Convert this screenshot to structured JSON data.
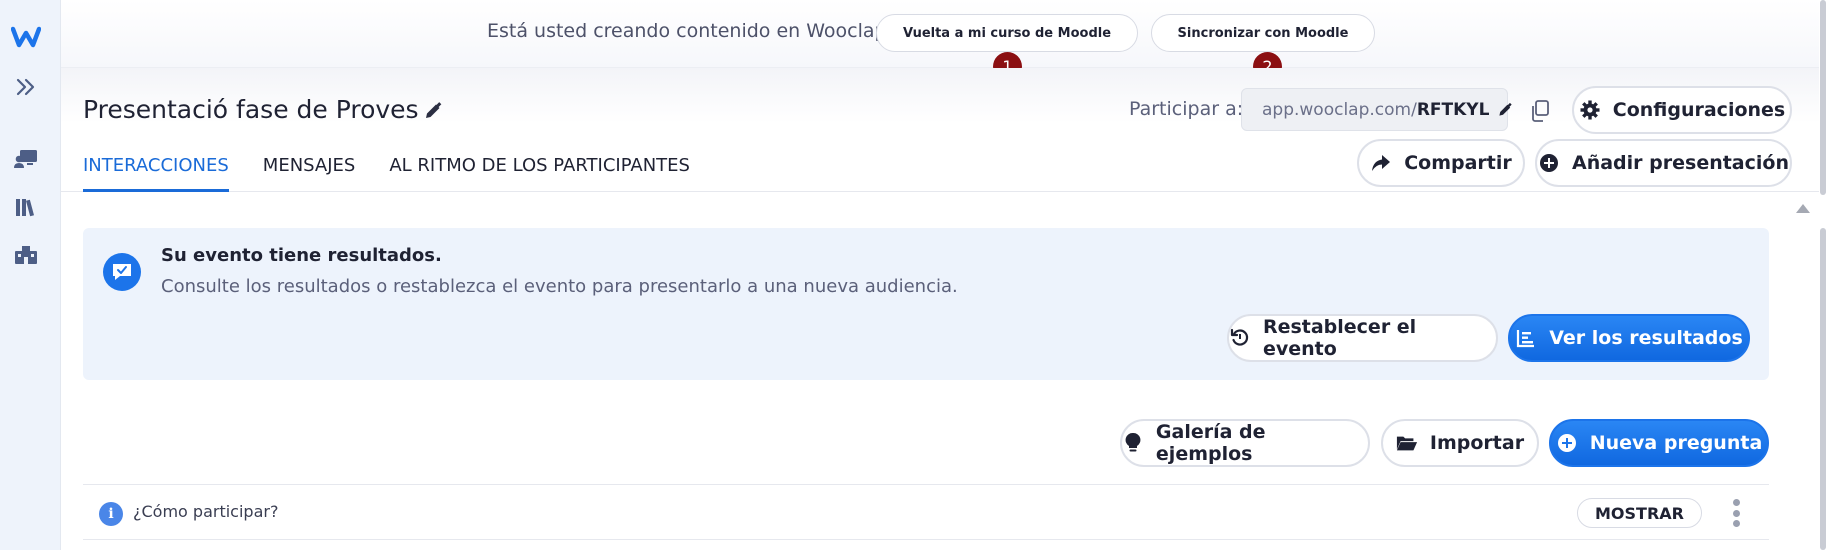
{
  "rail": {
    "logo": "w-logo",
    "items": [
      "expand-icon",
      "presenter-icon",
      "library-icon",
      "institution-icon"
    ]
  },
  "banner": {
    "text": "Está usted creando contenido en Wooclap.",
    "back_button": "Vuelta a mi curso de Moodle",
    "sync_button": "Sincronizar con Moodle",
    "badge_1": "1",
    "badge_2": "2"
  },
  "header": {
    "title": "Presentació fase de Proves",
    "participate_label": "Participar a:",
    "url_prefix": "app.wooclap.com/",
    "url_code": "RFTKYL",
    "settings_button": "Configuraciones",
    "share_button": "Compartir",
    "add_presentation_button": "Añadir presentación",
    "tabs": [
      {
        "label": "INTERACCIONES",
        "active": true
      },
      {
        "label": "MENSAJES",
        "active": false
      },
      {
        "label": "AL RITMO DE LOS PARTICIPANTES",
        "active": false
      }
    ]
  },
  "notice": {
    "title": "Su evento tiene resultados.",
    "text": "Consulte los resultados o restablezca el evento para presentarlo a una nueva audiencia.",
    "reset_button": "Restablecer el evento",
    "results_button": "Ver los resultados"
  },
  "toolbar": {
    "gallery_button": "Galería de ejemplos",
    "import_button": "Importar",
    "new_question_button": "Nueva pregunta"
  },
  "question": {
    "info_icon": "i",
    "text": "¿Cómo participar?",
    "show_button": "MOSTRAR"
  },
  "colors": {
    "primary": "#1c74ea",
    "badge": "#8b0f12",
    "active_tab": "#1a6bd8",
    "notice_bg": "#edf3fc"
  }
}
